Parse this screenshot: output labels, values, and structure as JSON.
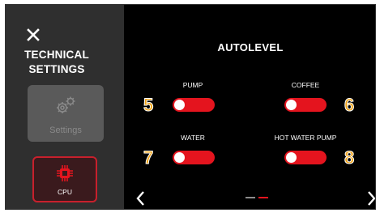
{
  "sidebar": {
    "title_line1": "TECHNICAL",
    "title_line2": "SETTINGS",
    "settings_label": "Settings",
    "cpu_label": "CPU"
  },
  "main": {
    "title": "AUTOLEVEL",
    "items": [
      {
        "label": "PUMP",
        "number": "5",
        "toggle_state": "off"
      },
      {
        "label": "COFFEE",
        "number": "6",
        "toggle_state": "off"
      },
      {
        "label": "WATER",
        "number": "7",
        "toggle_state": "off"
      },
      {
        "label": "HOT WATER PUMP",
        "number": "8",
        "toggle_state": "off"
      }
    ]
  },
  "pagination": {
    "pages": 2,
    "current": 2
  },
  "colors": {
    "accent_red": "#e4141e",
    "number_orange": "#f2a417",
    "sidebar_bg": "#2f2f2f",
    "disabled_button_bg": "#5a5a5a"
  },
  "icons": [
    "close-icon",
    "gear-icon",
    "cpu-chip-icon",
    "chevron-left-icon",
    "chevron-right-icon"
  ]
}
